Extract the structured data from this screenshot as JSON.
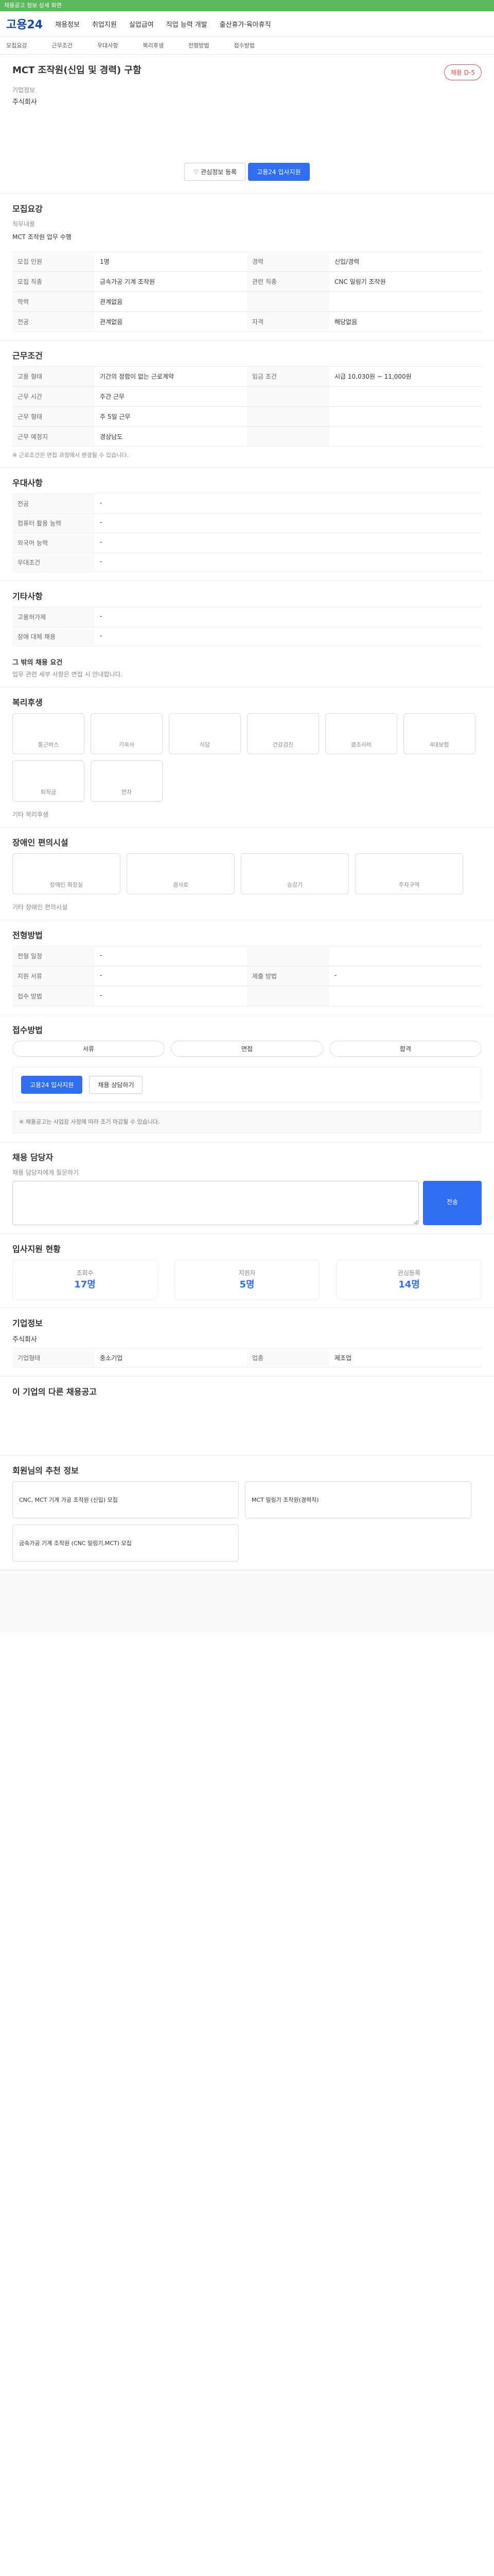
{
  "banner": {
    "text": "채용공고 정보 상세 화면"
  },
  "nav": {
    "logo": "고용24",
    "items": [
      "채용정보",
      "취업지원",
      "실업급여",
      "직업 능력 개발",
      "출산휴가·육아휴직"
    ]
  },
  "subnav": {
    "items": [
      "모집요강",
      "근무조건",
      "우대사항",
      "복리후생",
      "전형방법",
      "접수방법"
    ]
  },
  "job": {
    "title": "MCT 조작원(신입 및 경력) 구함",
    "badge": "채용 D-5",
    "company_label": "기업정보",
    "company": "주식회사",
    "apply_label": "고용24 입사지원",
    "fav_label": "관심정보 등록"
  },
  "recruit": {
    "title": "모집요강",
    "job_section_label": "직무내용",
    "job_desc": "MCT 조작원 업무 수행",
    "rows": [
      {
        "k1": "모집 인원",
        "v1": "1명",
        "k2": "경력",
        "v2": "신입/경력"
      },
      {
        "k1": "모집 직종",
        "v1": "금속가공 기계 조작원",
        "k2": "관련 직종",
        "v2": "CNC 밀링기 조작원"
      },
      {
        "k1": "학력",
        "v1": "관계없음",
        "k2": "",
        "v2": ""
      },
      {
        "k1": "전공",
        "v1": "관계없음",
        "k2": "자격",
        "v2": "해당없음"
      }
    ]
  },
  "conditions": {
    "title": "근무조건",
    "rows": [
      {
        "k1": "고용 형태",
        "v1": "기간의 정함이 없는 근로계약",
        "k2": "임금 조건",
        "v2": "시급 10,030원 ~ 11,000원"
      },
      {
        "k1": "근무 시간",
        "v1": "주간 근무",
        "k2": "",
        "v2": ""
      },
      {
        "k1": "근무 형태",
        "v1": "주 5일 근무",
        "k2": "",
        "v2": ""
      },
      {
        "k1": "근무 예정지",
        "v1": "경상남도",
        "k2": "",
        "v2": ""
      }
    ],
    "note": "※ 근로조건은 면접 과정에서 변경될 수 있습니다."
  },
  "preference": {
    "title": "우대사항",
    "rows": [
      {
        "k": "전공",
        "v": "-"
      },
      {
        "k": "컴퓨터 활용 능력",
        "v": "-"
      },
      {
        "k": "외국어 능력",
        "v": "-"
      },
      {
        "k": "우대조건",
        "v": "-"
      }
    ]
  },
  "etc": {
    "title": "기타사항",
    "rows": [
      {
        "k": "고용허가제",
        "v": "-"
      },
      {
        "k": "장애 대체 채용",
        "v": "-"
      }
    ],
    "heading": "그 밖의 채용 요건",
    "text": "업무 관련 세부 사항은 면접 시 안내합니다."
  },
  "welfare": {
    "title": "복리후생",
    "items": [
      "통근버스",
      "기숙사",
      "식당",
      "건강검진",
      "경조사비",
      "4대보험",
      "퇴직금",
      "연차"
    ],
    "other_label": "기타 복리후생"
  },
  "facility": {
    "title": "장애인 편의시설",
    "items": [
      "장애인 화장실",
      "경사로",
      "승강기",
      "주차구역"
    ],
    "other_label": "기타 장애인 편의시설"
  },
  "process": {
    "title": "전형방법",
    "rows": [
      {
        "k1": "전형 일정",
        "v1": "-",
        "k2": "",
        "v2": ""
      },
      {
        "k1": "지원 서류",
        "v1": "-",
        "k2": "제출 방법",
        "v2": "-"
      },
      {
        "k1": "접수 방법",
        "v1": "-",
        "k2": "",
        "v2": ""
      }
    ]
  },
  "apply": {
    "title": "접수방법",
    "steps": [
      "서류",
      "면접",
      "합격"
    ],
    "apply_label": "고용24 입사지원",
    "consult_label": "채용 상담하기",
    "notice": "※ 채용공고는 사업장 사정에 따라 조기 마감될 수 있습니다."
  },
  "stats": {
    "title": "입사지원 현황",
    "items": [
      {
        "label": "조회수",
        "value": "17명"
      },
      {
        "label": "지원자",
        "value": "5명"
      },
      {
        "label": "관심등록",
        "value": "14명"
      }
    ]
  },
  "manager": {
    "title": "채용 담당자",
    "contact_label": "채용 담당자에게 질문하기",
    "send_label": "전송"
  },
  "company_info": {
    "title": "기업정보",
    "name": "주식회사",
    "rows": [
      {
        "k": "기업형태",
        "v": "중소기업"
      },
      {
        "k": "업종",
        "v": "제조업"
      }
    ]
  },
  "similar": {
    "title": "이 기업의 다른 채용공고"
  },
  "recommend": {
    "title": "회원님의 추천 정보",
    "items": [
      "CNC, MCT 기계 가공 조작원 (신입) 모집",
      "MCT 밀링기 조작원(경력직)",
      "금속가공 기계 조작원 (CNC 밀링기,MCT) 모집"
    ]
  }
}
